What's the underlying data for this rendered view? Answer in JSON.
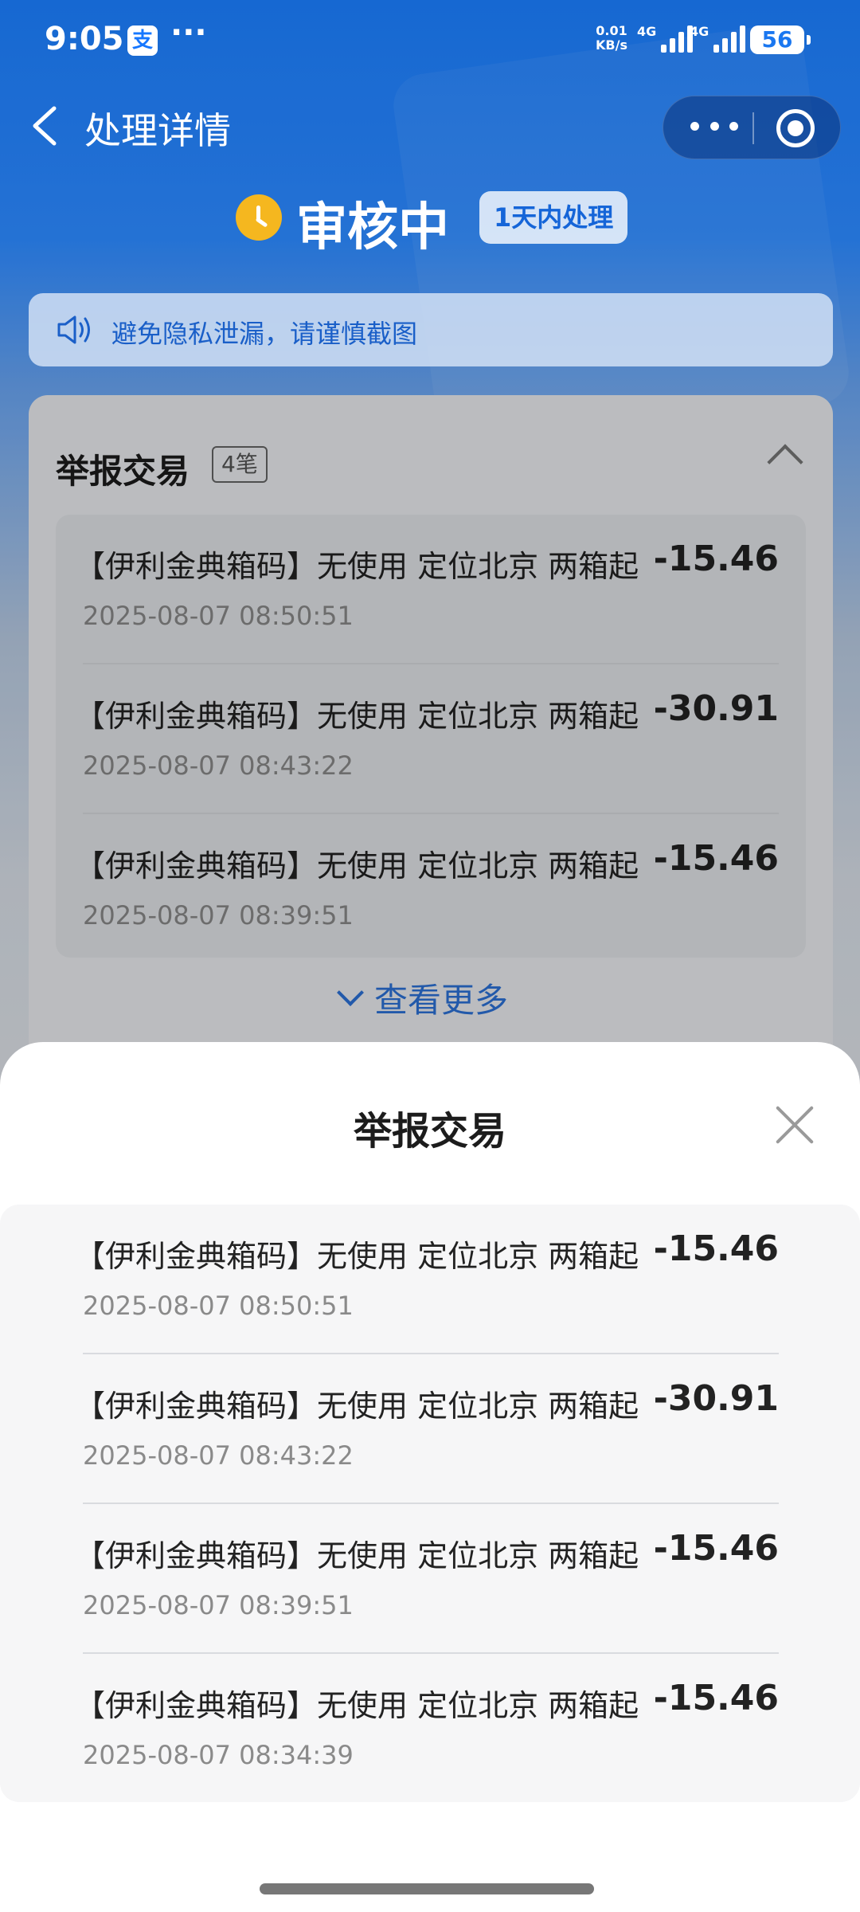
{
  "status_bar": {
    "time": "9:05",
    "app_icon": "支",
    "dots": "···",
    "speed_value": "0.01",
    "speed_unit": "KB/s",
    "net1": "4G",
    "net2": "4G",
    "battery": "56"
  },
  "nav": {
    "title": "处理详情"
  },
  "status": {
    "text": "审核中",
    "badge": "1天内处理"
  },
  "notice": {
    "text": "避免隐私泄漏，请谨慎截图"
  },
  "card": {
    "title": "举报交易",
    "count": "4笔",
    "see_more": "查看更多",
    "items": [
      {
        "name": "【伊利金典箱码】无使用 定位北京 两箱起",
        "amount": "-15.46",
        "time": "2025-08-07 08:50:51"
      },
      {
        "name": "【伊利金典箱码】无使用 定位北京 两箱起",
        "amount": "-30.91",
        "time": "2025-08-07 08:43:22"
      },
      {
        "name": "【伊利金典箱码】无使用 定位北京 两箱起",
        "amount": "-15.46",
        "time": "2025-08-07 08:39:51"
      }
    ]
  },
  "sheet": {
    "title": "举报交易",
    "items": [
      {
        "name": "【伊利金典箱码】无使用 定位北京 两箱起",
        "amount": "-15.46",
        "time": "2025-08-07 08:50:51"
      },
      {
        "name": "【伊利金典箱码】无使用 定位北京 两箱起",
        "amount": "-30.91",
        "time": "2025-08-07 08:43:22"
      },
      {
        "name": "【伊利金典箱码】无使用 定位北京 两箱起",
        "amount": "-15.46",
        "time": "2025-08-07 08:39:51"
      },
      {
        "name": "【伊利金典箱码】无使用 定位北京 两箱起",
        "amount": "-15.46",
        "time": "2025-08-07 08:34:39"
      }
    ]
  },
  "colors": {
    "brand_blue": "#1a77f0",
    "clock_yellow": "#f5b71f",
    "link_blue": "#2c72d8"
  }
}
